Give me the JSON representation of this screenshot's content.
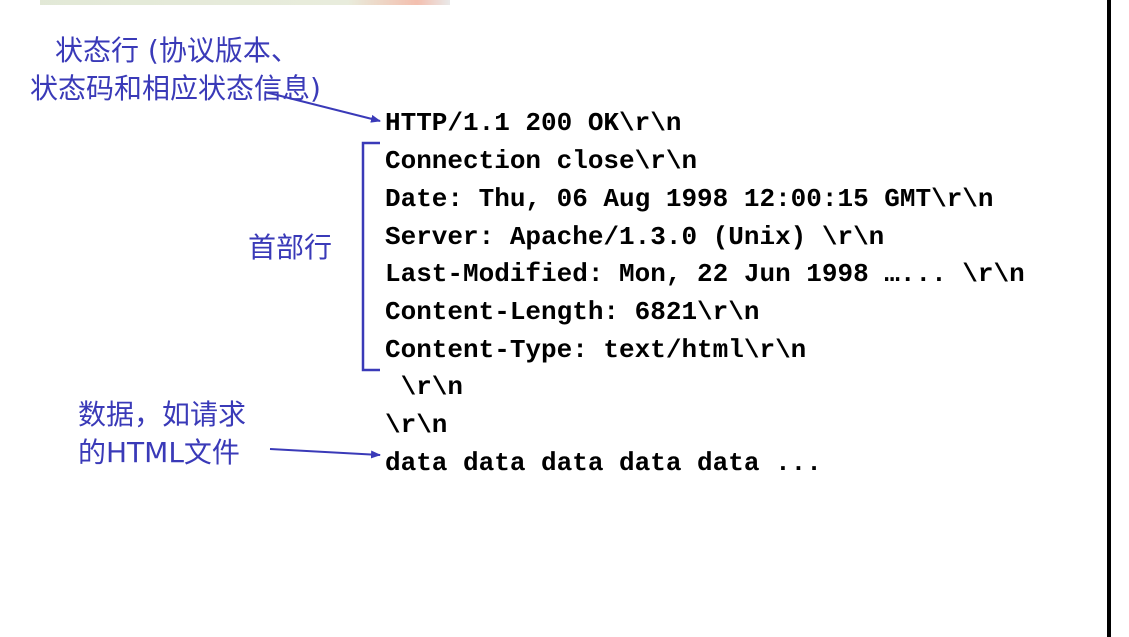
{
  "annotations": {
    "status_line": {
      "line1": "状态行 (协议版本、",
      "line2": "状态码和相应状态信息)"
    },
    "header_lines": "首部行",
    "data": {
      "line1": "数据，如请求",
      "line2": "的HTML文件"
    }
  },
  "message_lines": [
    "HTTP/1.1 200 OK\\r\\n",
    "Connection close\\r\\n",
    "Date: Thu, 06 Aug 1998 12:00:15 GMT\\r\\n",
    "Server: Apache/1.3.0 (Unix) \\r\\n",
    "Last-Modified: Mon, 22 Jun 1998 …... \\r\\n",
    "Content-Length: 6821\\r\\n",
    "Content-Type: text/html\\r\\n",
    " \\r\\n",
    "\\r\\n",
    "data data data data data ..."
  ],
  "colors": {
    "annotation": "#3a3ab8",
    "code": "#000000",
    "border": "#000000"
  }
}
